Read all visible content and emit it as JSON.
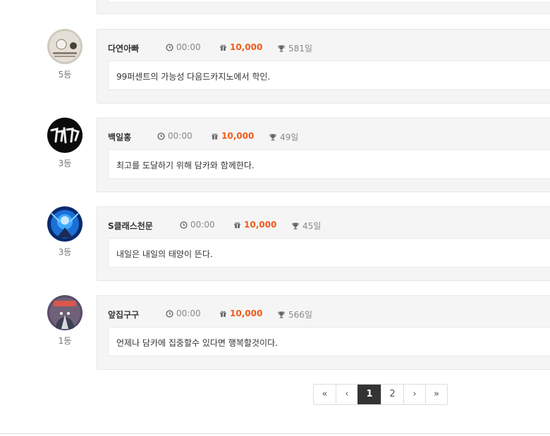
{
  "entries": [
    {
      "name": "다연아빠",
      "time": "00:00",
      "points": "10,000",
      "days": "581일",
      "rank": "5등",
      "message": "99퍼센트의 가능성 다음드카지노에서 학인.",
      "avatar_icon": "avatar-photo-icon"
    },
    {
      "name": "백일홍",
      "time": "00:00",
      "points": "10,000",
      "days": "49일",
      "rank": "3등",
      "message": "최고를 도달하기 위해 담카와 함께한다.",
      "avatar_icon": "avatar-photo-icon"
    },
    {
      "name": "S클래스천문",
      "time": "00:00",
      "points": "10,000",
      "days": "45일",
      "rank": "3등",
      "message": "내일은 내일의 태양이 뜬다.",
      "avatar_icon": "avatar-photo-icon"
    },
    {
      "name": "앞집구구",
      "time": "00:00",
      "points": "10,000",
      "days": "566일",
      "rank": "1등",
      "message": "언제나 담카에 집중할수 있다면 행복할것이다.",
      "avatar_icon": "avatar-photo-icon"
    }
  ],
  "pagination": {
    "first": "«",
    "prev": "‹",
    "pages": [
      "1",
      "2"
    ],
    "current": "1",
    "next": "›",
    "last": "»"
  },
  "colors": {
    "points": "#f05a1a",
    "active_page": "#333333",
    "card_bg": "#f5f5f5"
  },
  "icons": {
    "time": "clock-icon",
    "points": "gift-icon",
    "days": "trophy-icon"
  }
}
